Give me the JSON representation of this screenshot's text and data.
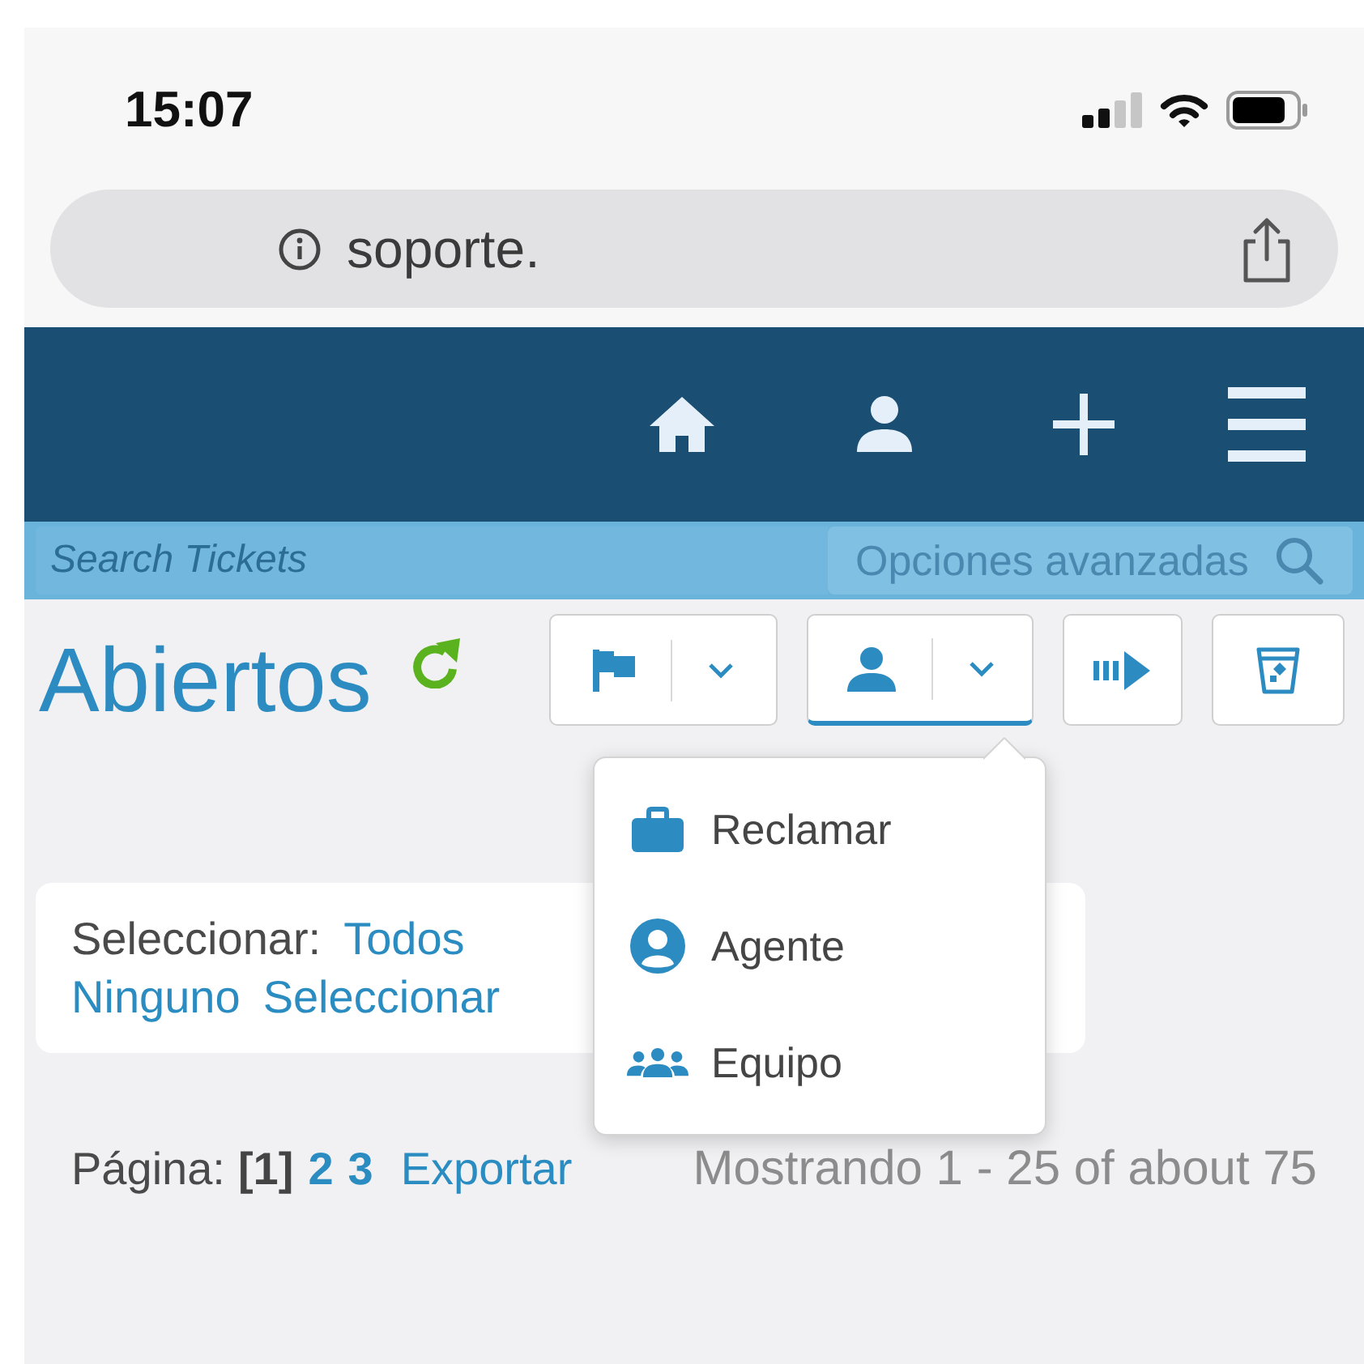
{
  "status_bar": {
    "time": "15:07"
  },
  "address_bar": {
    "url": "soporte."
  },
  "search": {
    "placeholder": "Search Tickets",
    "advanced": "Opciones avanzadas"
  },
  "title": "Abiertos",
  "toolbar": [
    {
      "kind": "split",
      "expanded": false
    },
    {
      "kind": "split",
      "expanded": true,
      "menu": [
        "Reclamar",
        "Agente",
        "Equipo"
      ]
    },
    {
      "kind": "plain",
      "expanded": false
    },
    {
      "kind": "plain",
      "expanded": false
    }
  ],
  "select_bar": {
    "label": "Seleccionar:",
    "links": [
      "Todos",
      "Ninguno",
      "Seleccionar"
    ]
  },
  "pagination": {
    "label": "Página:",
    "pages": [
      {
        "label": "[1]",
        "selected": true
      },
      {
        "label": "2",
        "selected": false
      },
      {
        "label": "3",
        "selected": false
      }
    ],
    "export": "Exportar",
    "summary": "Mostrando 1 - 25 of about 75"
  }
}
